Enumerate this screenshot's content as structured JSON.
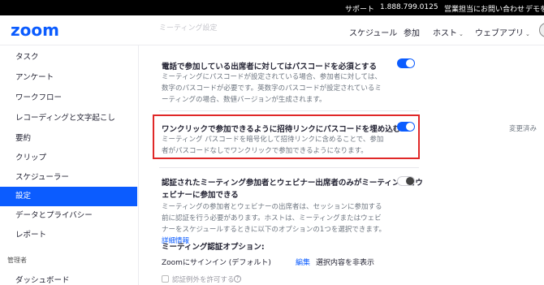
{
  "topbar": {
    "support": "サポート",
    "phone": "1.888.799.0125",
    "contact_sales": "営業担当にお問い合わせ",
    "demo": "デモを"
  },
  "header": {
    "logo": "zoom",
    "faded_breadcrumb": "ミーティング設定",
    "nav": {
      "schedule": "スケジュール",
      "join": "参加",
      "host": "ホスト",
      "webapp": "ウェブアプリ"
    }
  },
  "sidebar": {
    "items": [
      {
        "label": "タスク"
      },
      {
        "label": "アンケート"
      },
      {
        "label": "ワークフロー"
      },
      {
        "label": "レコーディングと文字起こし"
      },
      {
        "label": "要約"
      },
      {
        "label": "クリップ"
      },
      {
        "label": "スケジューラー"
      },
      {
        "label": "設定"
      },
      {
        "label": "データとプライバシー"
      },
      {
        "label": "レポート"
      }
    ],
    "admin_section": "管理者",
    "dashboard": "ダッシュボード"
  },
  "settings": {
    "phone_passcode": {
      "title": "電話で参加している出席者に対してはパスコードを必須とする",
      "desc": "ミーティングにパスコードが設定されている場合、参加者に対しては、数字のパスコードが必要です。英数字のパスコードが設定されているミーティングの場合、数値バージョンが生成されます。",
      "state": "on"
    },
    "embed_passcode": {
      "title": "ワンクリックで参加できるように招待リンクにパスコードを埋め込む",
      "desc": "ミーティング パスコードを暗号化して招待リンクに含めることで、参加者がパスコードなしでワンクリックで参加できるようになります。",
      "state": "on",
      "changed_note": "変更済み"
    },
    "authenticated_only": {
      "title_line1": "認証されたミーティング参加者とウェビナー出席者のみがミーティングとウ",
      "title_line2": "ェビナーに参加できる",
      "desc": "ミーティングの参加者とウェビナーの出席者は、セッションに参加する前に認証を行う必要があります。ホストは、ミーティングまたはウェビナーをスケジュールするときに以下のオプションの1つを選択できます。",
      "details_link": "詳細情報",
      "state": "off"
    },
    "auth_options": {
      "heading": "ミーティング認証オプション:",
      "option_label": "Zoomにサインイン (デフォルト)",
      "edit": "編集",
      "hide": "選択内容を非表示",
      "exception_label": "認証例外を許可する"
    }
  },
  "colors": {
    "accent": "#0b5cff",
    "highlight_border": "#e02828"
  }
}
